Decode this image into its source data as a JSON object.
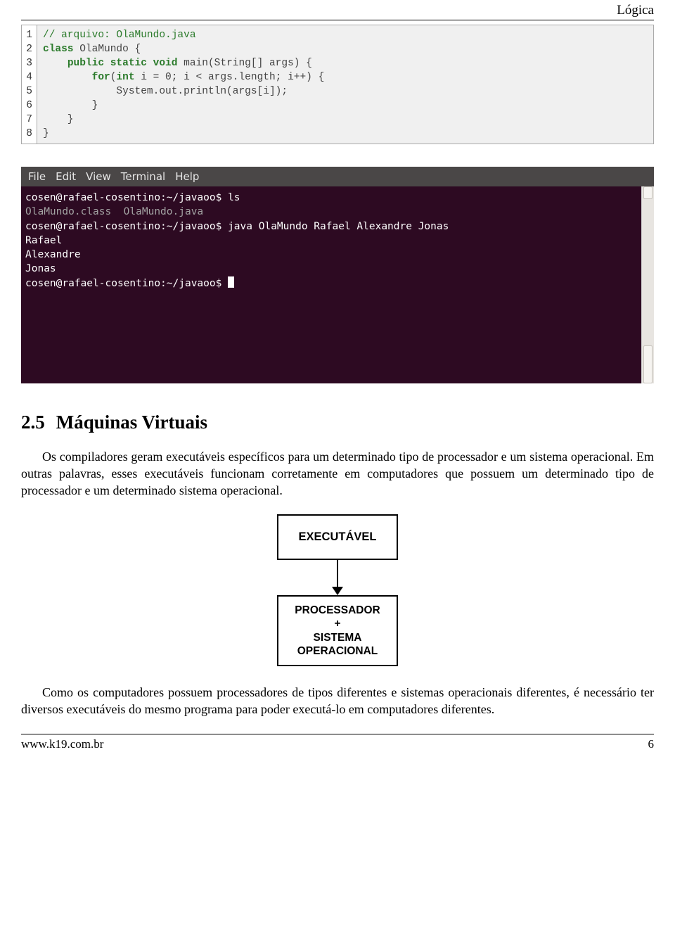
{
  "header": {
    "chapter": "Lógica"
  },
  "code": {
    "linenums": [
      "1",
      "2",
      "3",
      "4",
      "5",
      "6",
      "7",
      "8"
    ],
    "l1_comment": "// arquivo: OlaMundo.java",
    "l2_kw1": "class",
    "l2_name": " OlaMundo {",
    "l3_kw1": "public static void",
    "l3_rest": " main(String[] args) {",
    "l4_kw1": "for",
    "l4_paren": "(",
    "l4_kw2": "int",
    "l4_rest": " i = 0; i < args.length; i++) {",
    "l5": "            System.out.println(args[i]);",
    "l6": "        }",
    "l7": "    }",
    "l8": "}"
  },
  "terminal": {
    "menu": [
      "File",
      "Edit",
      "View",
      "Terminal",
      "Help"
    ],
    "lines": [
      "cosen@rafael-cosentino:~/javaoo$ ls",
      "OlaMundo.class  OlaMundo.java",
      "cosen@rafael-cosentino:~/javaoo$ java OlaMundo Rafael Alexandre Jonas",
      "Rafael",
      "Alexandre",
      "Jonas",
      "cosen@rafael-cosentino:~/javaoo$ "
    ]
  },
  "section": {
    "num": "2.5",
    "title": "Máquinas Virtuais"
  },
  "paras": {
    "p1": "Os compiladores geram executáveis específicos para um determinado tipo de processador e um sistema operacional. Em outras palavras, esses executáveis funcionam corretamente em computadores que possuem um determinado tipo de processador e um determinado sistema operacional.",
    "p2": "Como os computadores possuem processadores de tipos diferentes e sistemas operacionais diferentes, é necessário ter diversos executáveis do mesmo programa para poder executá-lo em computadores diferentes."
  },
  "diagram": {
    "box1": "EXECUTÁVEL",
    "box2_l1": "PROCESSADOR",
    "box2_l2": "+",
    "box2_l3": "SISTEMA",
    "box2_l4": "OPERACIONAL"
  },
  "footer": {
    "url": "www.k19.com.br",
    "page": "6"
  }
}
